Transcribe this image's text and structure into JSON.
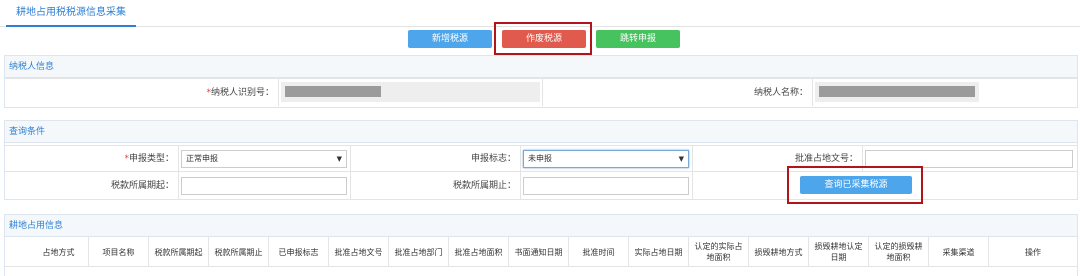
{
  "tab": {
    "label": "耕地占用税税源信息采集"
  },
  "toolbar": {
    "add_label": "新增税源",
    "void_label": "作废税源",
    "jump_label": "跳转申报"
  },
  "taxpayer": {
    "section_title": "纳税人信息",
    "id_required": "*",
    "id_label": "纳税人识别号：",
    "name_label": "纳税人名称："
  },
  "query": {
    "section_title": "查询条件",
    "decl_type_required": "*",
    "decl_type_label": "申报类型：",
    "decl_type_value": "正常申报",
    "decl_flag_label": "申报标志：",
    "decl_flag_value": "未申报",
    "approval_no_label": "批准占地文号：",
    "period_start_label": "税款所属期起：",
    "period_end_label": "税款所属期止：",
    "query_button": "查询已采集税源"
  },
  "occupation": {
    "section_title": "耕地占用信息",
    "columns": [
      "占地方式",
      "项目名称",
      "税款所属期起",
      "税款所属期止",
      "已申报标志",
      "批准占地文号",
      "批准占地部门",
      "批准占地面积",
      "书面通知日期",
      "批准时间",
      "实际占地日期",
      "认定的实际占地面积",
      "损毁耕地方式",
      "损毁耕地认定日期",
      "认定的损毁耕地面积",
      "采集渠道",
      "操作"
    ]
  },
  "icons": {
    "caret": "caret-down-icon"
  }
}
